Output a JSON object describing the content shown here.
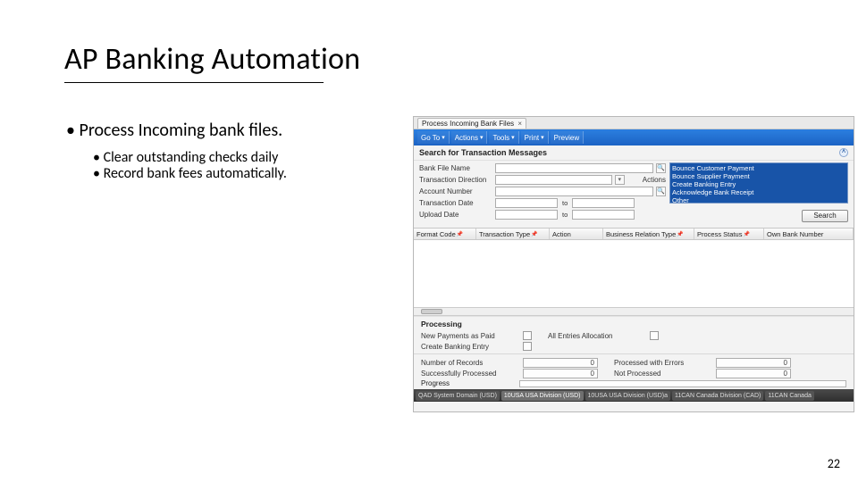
{
  "slide": {
    "title": "AP Banking Automation",
    "bullet1": "Process Incoming bank files.",
    "sub1": "Clear outstanding checks daily",
    "sub2": "Record bank fees automatically.",
    "page_number": "22"
  },
  "app": {
    "tab_title": "Process Incoming Bank Files",
    "tab_close": "×",
    "toolbar": {
      "goto": "Go To",
      "actions": "Actions",
      "tools": "Tools",
      "print": "Print",
      "preview": "Preview",
      "chev": "▾"
    },
    "search_header": "Search for Transaction Messages",
    "collapse_glyph": "˄",
    "form": {
      "bank_file_name": "Bank File Name",
      "transaction_direction": "Transaction Direction",
      "account_number": "Account Number",
      "transaction_date": "Transaction Date",
      "upload_date": "Upload Date",
      "to": "to",
      "mag": "🔍",
      "drop": "▾",
      "actions_label": "Actions"
    },
    "actions_list": [
      "Bounce Customer Payment",
      "Bounce Supplier Payment",
      "Create Banking Entry",
      "Acknowledge Bank Receipt",
      "Other"
    ],
    "search_btn": "Search",
    "grid_headers": {
      "format_code": "Format Code",
      "transaction_type": "Transaction Type",
      "action": "Action",
      "business_relation_type": "Business Relation Type",
      "process_status": "Process Status",
      "own_bank_number": "Own Bank Number",
      "pin": "📌"
    },
    "processing": {
      "header": "Processing",
      "new_payments": "New Payments as Paid",
      "create_banking_entry": "Create Banking Entry",
      "all_entries_allocation": "All Entries Allocation",
      "number_of_records": "Number of Records",
      "successfully_processed": "Successfully Processed",
      "processed_with_errors": "Processed with Errors",
      "not_processed": "Not Processed",
      "zero": "0",
      "progress": "Progress"
    },
    "status_tabs": [
      "QAD System Domain (USD)",
      "10USA USA Division (USD)",
      "10USA USA Division (USD)a",
      "11CAN Canada Division (CAD)",
      "11CAN Canada"
    ]
  }
}
